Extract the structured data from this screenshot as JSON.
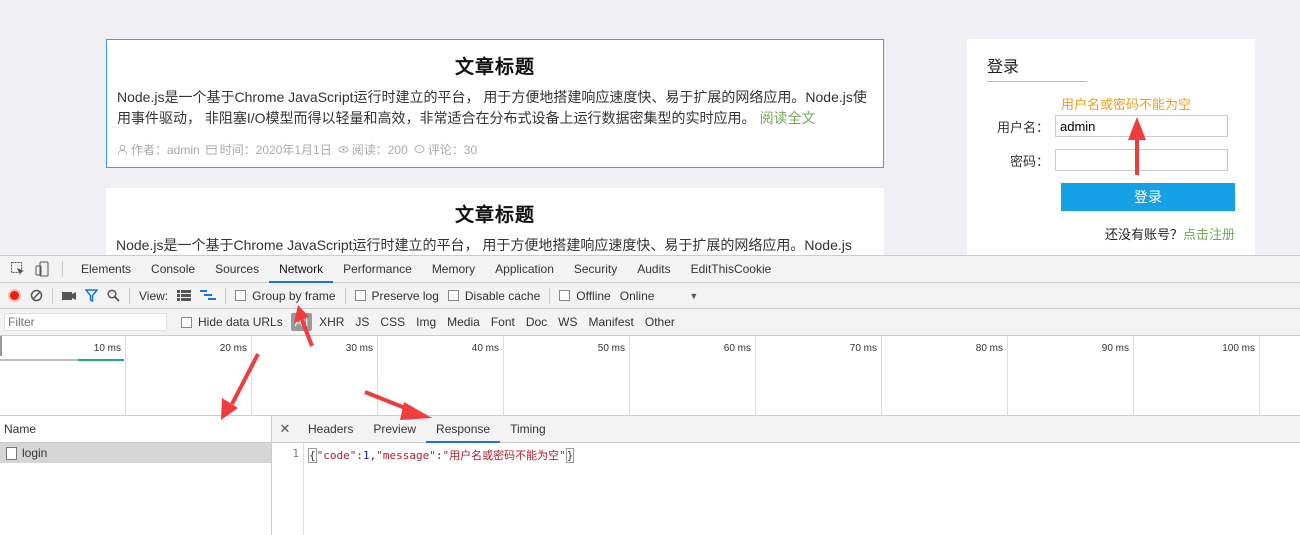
{
  "articles": [
    {
      "title": "文章标题",
      "body": "Node.js是一个基于Chrome JavaScript运行时建立的平台， 用于方便地搭建响应速度快、易于扩展的网络应用。Node.js使用事件驱动， 非阻塞I/O模型而得以轻量和高效，非常适合在分布式设备上运行数据密集型的实时应用。",
      "more": "阅读全文",
      "meta": {
        "author": "作者：admin",
        "time": "时间：2020年1月1日",
        "views": "阅读：200",
        "comments": "评论：30"
      }
    },
    {
      "title": "文章标题",
      "body": "Node.js是一个基于Chrome JavaScript运行时建立的平台， 用于方便地搭建响应速度快、易于扩展的网络应用。Node.js"
    }
  ],
  "login": {
    "title": "登录",
    "error": "用户名或密码不能为空",
    "username_label": "用户名：",
    "username_value": "admin",
    "password_label": "密码：",
    "submit": "登录",
    "register_prompt": "还没有账号？",
    "register_link": "点击注册"
  },
  "devtools": {
    "tabs": [
      "Elements",
      "Console",
      "Sources",
      "Network",
      "Performance",
      "Memory",
      "Application",
      "Security",
      "Audits",
      "EditThisCookie"
    ],
    "active_tab": "Network",
    "toolbar": {
      "view_label": "View:",
      "group_by_frame": "Group by frame",
      "preserve_log": "Preserve log",
      "disable_cache": "Disable cache",
      "offline": "Offline",
      "throttle": "Online"
    },
    "filter": {
      "placeholder": "Filter",
      "hide_data_urls": "Hide data URLs",
      "types": [
        "All",
        "XHR",
        "JS",
        "CSS",
        "Img",
        "Media",
        "Font",
        "Doc",
        "WS",
        "Manifest",
        "Other"
      ],
      "selected_type": "All"
    },
    "timeline_ticks": [
      "10 ms",
      "20 ms",
      "30 ms",
      "40 ms",
      "50 ms",
      "60 ms",
      "70 ms",
      "80 ms",
      "90 ms",
      "100 ms"
    ],
    "name_header": "Name",
    "requests": [
      "login"
    ],
    "detail_tabs": [
      "Headers",
      "Preview",
      "Response",
      "Timing"
    ],
    "active_detail_tab": "Response",
    "response": {
      "line_number": "1",
      "open": "{",
      "k1": "\"code\"",
      "colon": ":",
      "v1": "1",
      "comma": ",",
      "k2": "\"message\"",
      "v2": "\"用户名或密码不能为空\"",
      "close": "}"
    }
  },
  "colors": {
    "accent": "#1a73e8",
    "error": "#f0a020",
    "link_green": "#77a85a",
    "login_button": "#16a0e6",
    "arrow": "#f03c3c"
  }
}
